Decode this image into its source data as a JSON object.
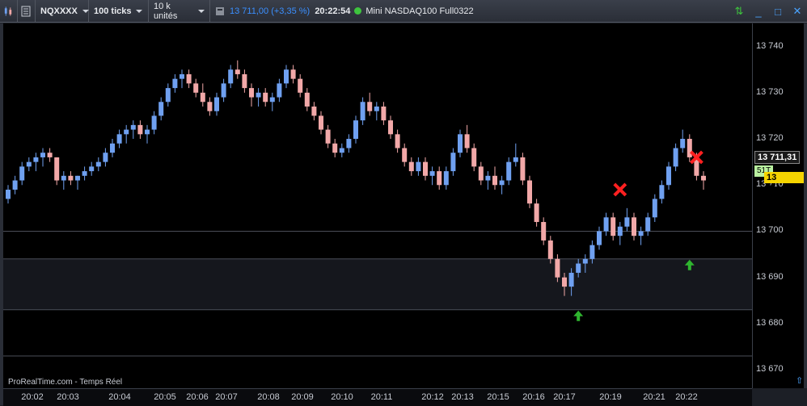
{
  "toolbar": {
    "instrument": "NQXXXX",
    "ticks": "100 ticks",
    "units": "10 k unités",
    "last_price": "13 711,00",
    "change": "(+3,35 %)",
    "time": "20:22:54",
    "description": "Mini NASDAQ100 Full0322"
  },
  "watermark": "ProRealTime.com - Temps Réel",
  "colors": {
    "up": "#6fa0f0",
    "down": "#f2a8a8",
    "bg": "#000000",
    "accent": "#3a8fff",
    "tag_last": "#f5d400",
    "tag_vol": "#b9f0a0"
  },
  "price_tags": {
    "current": "13 711,31",
    "volume": "51T",
    "last": "13 711,00"
  },
  "chart_data": {
    "type": "candlestick",
    "y_ticks": [
      "13 740",
      "13 730",
      "13 720",
      "13 710",
      "13 700",
      "13 690",
      "13 680",
      "13 670"
    ],
    "x_ticks": [
      "20:02",
      "20:03",
      "20:04",
      "20:05",
      "20:06",
      "20:07",
      "20:08",
      "20:09",
      "20:10",
      "20:11",
      "20:12",
      "20:13",
      "20:15",
      "20:16",
      "20:17",
      "20:19",
      "20:21",
      "20:22"
    ],
    "ylim": [
      13666,
      13745
    ],
    "candles": [
      [
        13707,
        13710,
        13706,
        13709
      ],
      [
        13709,
        13712,
        13708,
        13711
      ],
      [
        13711,
        13715,
        13710,
        13714
      ],
      [
        13714,
        13716,
        13713,
        13715
      ],
      [
        13715,
        13717,
        13713,
        13716
      ],
      [
        13716,
        13718,
        13714,
        13717
      ],
      [
        13717,
        13718,
        13715,
        13716
      ],
      [
        13716,
        13716,
        13710,
        13711
      ],
      [
        13711,
        13713,
        13709,
        13712
      ],
      [
        13712,
        13713,
        13710,
        13711
      ],
      [
        13711,
        13712,
        13709,
        13712
      ],
      [
        13712,
        13714,
        13711,
        13713
      ],
      [
        13713,
        13715,
        13712,
        13714
      ],
      [
        13714,
        13716,
        13713,
        13715
      ],
      [
        13715,
        13718,
        13714,
        13717
      ],
      [
        13717,
        13720,
        13716,
        13719
      ],
      [
        13719,
        13722,
        13718,
        13721
      ],
      [
        13721,
        13723,
        13719,
        13722
      ],
      [
        13722,
        13724,
        13720,
        13723
      ],
      [
        13723,
        13724,
        13720,
        13721
      ],
      [
        13721,
        13723,
        13719,
        13722
      ],
      [
        13722,
        13726,
        13721,
        13725
      ],
      [
        13725,
        13729,
        13724,
        13728
      ],
      [
        13728,
        13732,
        13727,
        13731
      ],
      [
        13731,
        13734,
        13730,
        13733
      ],
      [
        13733,
        13735,
        13731,
        13734
      ],
      [
        13734,
        13735,
        13731,
        13732
      ],
      [
        13732,
        13733,
        13729,
        13730
      ],
      [
        13730,
        13732,
        13727,
        13728
      ],
      [
        13728,
        13729,
        13725,
        13726
      ],
      [
        13726,
        13730,
        13725,
        13729
      ],
      [
        13729,
        13733,
        13728,
        13732
      ],
      [
        13732,
        13736,
        13731,
        13735
      ],
      [
        13735,
        13737,
        13733,
        13734
      ],
      [
        13734,
        13735,
        13730,
        13731
      ],
      [
        13731,
        13732,
        13727,
        13729
      ],
      [
        13729,
        13731,
        13727,
        13730
      ],
      [
        13730,
        13731,
        13727,
        13728
      ],
      [
        13728,
        13730,
        13726,
        13729
      ],
      [
        13729,
        13733,
        13728,
        13732
      ],
      [
        13732,
        13736,
        13731,
        13735
      ],
      [
        13735,
        13736,
        13732,
        13733
      ],
      [
        13733,
        13734,
        13729,
        13730
      ],
      [
        13730,
        13731,
        13726,
        13727
      ],
      [
        13727,
        13728,
        13724,
        13725
      ],
      [
        13725,
        13726,
        13721,
        13722
      ],
      [
        13722,
        13723,
        13718,
        13719
      ],
      [
        13719,
        13720,
        13716,
        13717
      ],
      [
        13717,
        13719,
        13716,
        13718
      ],
      [
        13718,
        13721,
        13717,
        13720
      ],
      [
        13720,
        13725,
        13719,
        13724
      ],
      [
        13724,
        13729,
        13723,
        13728
      ],
      [
        13728,
        13730,
        13725,
        13726
      ],
      [
        13726,
        13728,
        13724,
        13727
      ],
      [
        13727,
        13728,
        13723,
        13724
      ],
      [
        13724,
        13725,
        13720,
        13721
      ],
      [
        13721,
        13722,
        13717,
        13718
      ],
      [
        13718,
        13719,
        13714,
        13715
      ],
      [
        13715,
        13716,
        13712,
        13713
      ],
      [
        13713,
        13716,
        13712,
        13715
      ],
      [
        13715,
        13716,
        13711,
        13712
      ],
      [
        13712,
        13714,
        13710,
        13713
      ],
      [
        13713,
        13714,
        13709,
        13710
      ],
      [
        13710,
        13714,
        13709,
        13713
      ],
      [
        13713,
        13718,
        13712,
        13717
      ],
      [
        13717,
        13722,
        13716,
        13721
      ],
      [
        13721,
        13723,
        13717,
        13718
      ],
      [
        13718,
        13719,
        13713,
        13714
      ],
      [
        13714,
        13715,
        13710,
        13711
      ],
      [
        13711,
        13713,
        13709,
        13712
      ],
      [
        13712,
        13714,
        13709,
        13710
      ],
      [
        13710,
        13712,
        13708,
        13711
      ],
      [
        13711,
        13716,
        13710,
        13715
      ],
      [
        13715,
        13719,
        13714,
        13716
      ],
      [
        13716,
        13717,
        13710,
        13711
      ],
      [
        13711,
        13712,
        13705,
        13706
      ],
      [
        13706,
        13707,
        13701,
        13702
      ],
      [
        13702,
        13703,
        13697,
        13698
      ],
      [
        13698,
        13699,
        13693,
        13694
      ],
      [
        13694,
        13695,
        13689,
        13690
      ],
      [
        13690,
        13691,
        13686,
        13688
      ],
      [
        13688,
        13692,
        13686,
        13691
      ],
      [
        13691,
        13694,
        13690,
        13693
      ],
      [
        13693,
        13695,
        13691,
        13694
      ],
      [
        13694,
        13698,
        13693,
        13697
      ],
      [
        13697,
        13701,
        13696,
        13700
      ],
      [
        13700,
        13704,
        13699,
        13703
      ],
      [
        13703,
        13704,
        13698,
        13699
      ],
      [
        13699,
        13702,
        13697,
        13701
      ],
      [
        13701,
        13705,
        13700,
        13703
      ],
      [
        13703,
        13704,
        13698,
        13699
      ],
      [
        13699,
        13701,
        13697,
        13700
      ],
      [
        13700,
        13704,
        13699,
        13703
      ],
      [
        13703,
        13708,
        13702,
        13707
      ],
      [
        13707,
        13711,
        13706,
        13710
      ],
      [
        13710,
        13715,
        13709,
        13714
      ],
      [
        13714,
        13719,
        13713,
        13718
      ],
      [
        13718,
        13722,
        13717,
        13720
      ],
      [
        13720,
        13721,
        13715,
        13716
      ],
      [
        13716,
        13717,
        13711,
        13712
      ],
      [
        13712,
        13713,
        13709,
        13711
      ]
    ],
    "horizontal_levels": [
      13700,
      13694,
      13683,
      13673
    ],
    "shaded_band": [
      13683,
      13694
    ],
    "buy_arrows": [
      {
        "index": 82,
        "price": 13683
      },
      {
        "index": 98,
        "price": 13694
      }
    ],
    "exit_marks": [
      {
        "index": 88,
        "price": 13709
      },
      {
        "index": 99,
        "price": 13716
      }
    ]
  }
}
